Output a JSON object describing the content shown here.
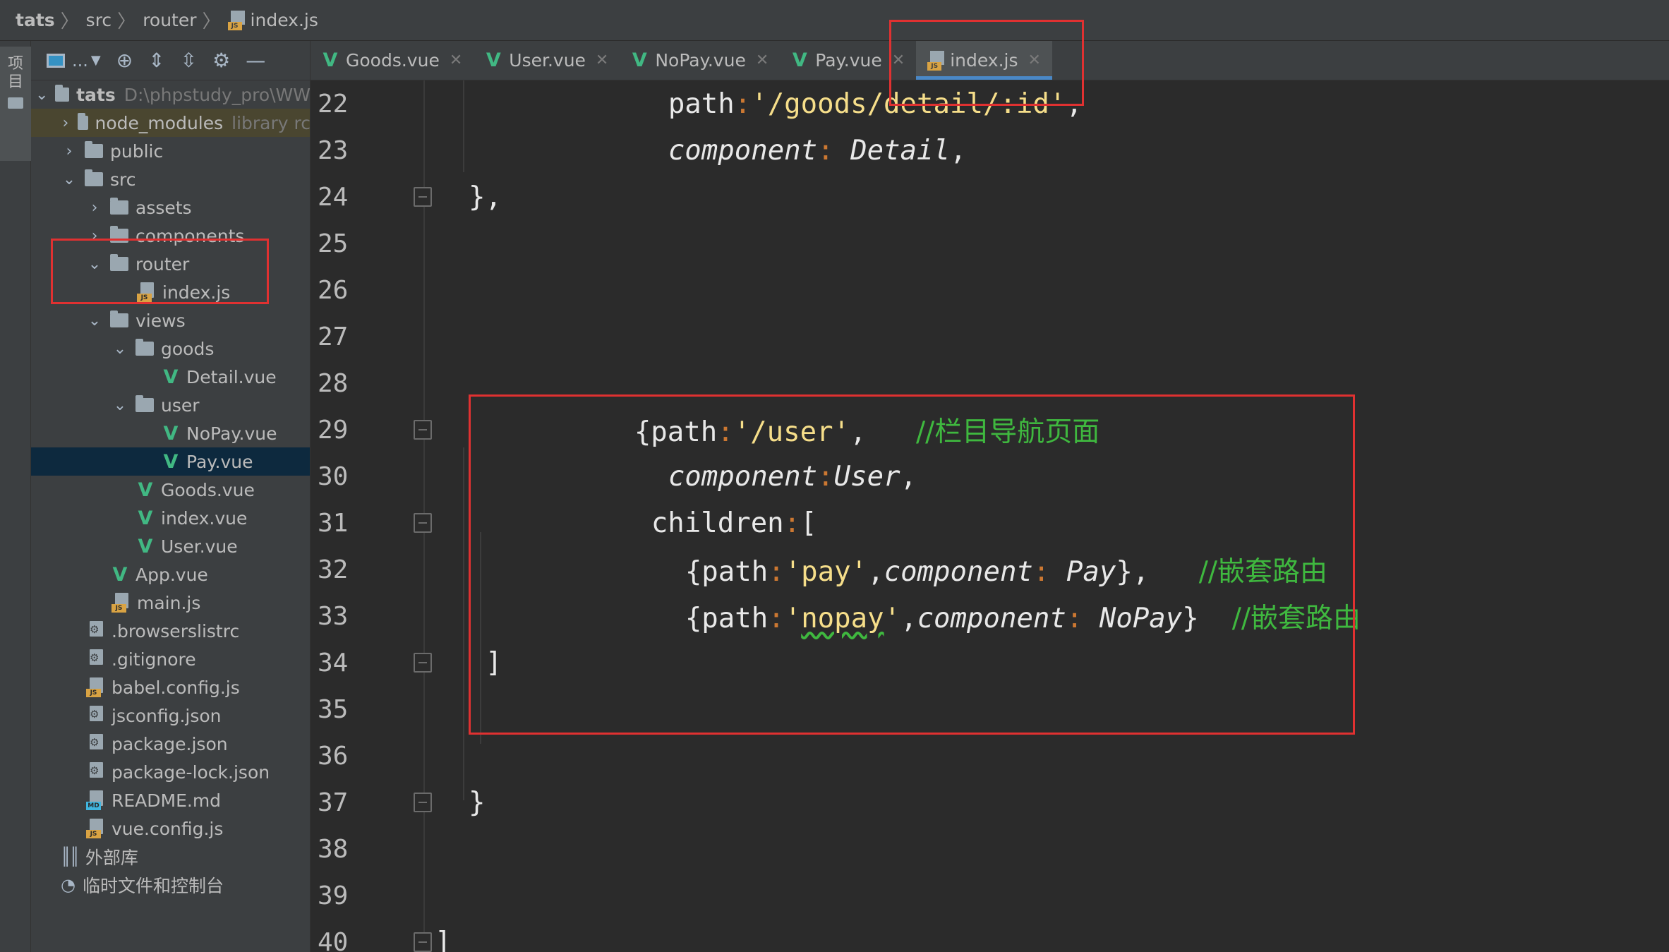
{
  "breadcrumb": {
    "items": [
      "tats",
      "src",
      "router",
      "index.js"
    ]
  },
  "left_strip": {
    "tab_label": "项目"
  },
  "toolbar": {
    "dots": "...",
    "icons": [
      "project-view-icon",
      "locate-icon",
      "expand-all-icon",
      "collapse-all-icon",
      "gear-icon",
      "minimize-icon"
    ]
  },
  "tree": {
    "root_name": "tats",
    "root_path": "D:\\phpstudy_pro\\WW",
    "node_modules": "node_modules",
    "node_modules_hint": "library rc",
    "public": "public",
    "src": "src",
    "assets": "assets",
    "components": "components",
    "router": "router",
    "router_index": "index.js",
    "views": "views",
    "goods": "goods",
    "detail": "Detail.vue",
    "user": "user",
    "nopay": "NoPay.vue",
    "pay": "Pay.vue",
    "goods_vue": "Goods.vue",
    "index_vue": "index.vue",
    "user_vue": "User.vue",
    "app_vue": "App.vue",
    "main_js": "main.js",
    "browserslistrc": ".browserslistrc",
    "gitignore": ".gitignore",
    "babel": "babel.config.js",
    "jsconfig": "jsconfig.json",
    "package": "package.json",
    "package_lock": "package-lock.json",
    "readme": "README.md",
    "vue_config": "vue.config.js",
    "external_libs": "外部库",
    "scratches": "临时文件和控制台"
  },
  "tabs": [
    {
      "label": "Goods.vue",
      "active": false
    },
    {
      "label": "User.vue",
      "active": false
    },
    {
      "label": "NoPay.vue",
      "active": false
    },
    {
      "label": "Pay.vue",
      "active": false
    },
    {
      "label": "index.js",
      "active": true
    }
  ],
  "code": {
    "line_numbers": [
      "22",
      "23",
      "24",
      "25",
      "26",
      "27",
      "28",
      "29",
      "30",
      "31",
      "32",
      "33",
      "34",
      "35",
      "36",
      "37",
      "38",
      "39",
      "40"
    ],
    "l22_key": "path",
    "l22_val": "'/goods/detail/:id'",
    "l23_key": "component",
    "l23_val": "Detail",
    "l24": "},",
    "l29_open": "{path",
    "l29_val": "'/user'",
    "l29_comment": "//栏目导航页面",
    "l30_key": "component",
    "l30_val": "User",
    "l31_key": "children",
    "l32_open": "{path",
    "l32_val": "'pay'",
    "l32_key2": "component",
    "l32_comp": "Pay",
    "l32_comment": "//嵌套路由",
    "l33_open": "{path",
    "l33_val_q1": "'",
    "l33_val_word": "nopay",
    "l33_val_q2": "'",
    "l33_key2": "component",
    "l33_comp": "NoPay",
    "l33_comment": "//嵌套路由",
    "l34": "]",
    "l37": "}",
    "l40": "]"
  },
  "colors": {
    "string": "#f6de8a",
    "comment": "#3fb83f",
    "vue": "#41b883",
    "annotation": "#e03131",
    "selection": "#0d293e",
    "tab_underline": "#4a88c7"
  }
}
